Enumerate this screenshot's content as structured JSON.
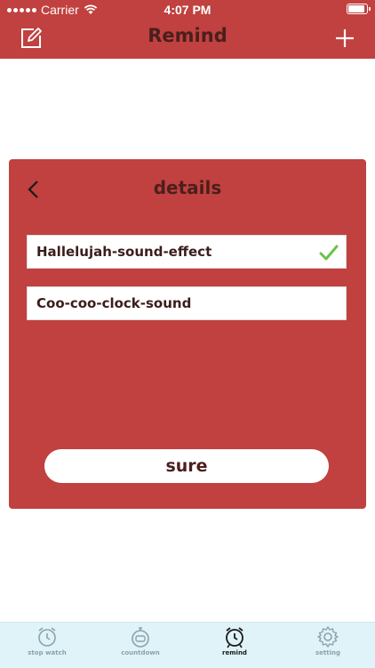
{
  "status_bar": {
    "carrier": "Carrier",
    "time": "4:07 PM"
  },
  "nav": {
    "title": "Remind",
    "left_icon": "edit-icon",
    "right_icon": "plus-icon"
  },
  "details_panel": {
    "title": "details",
    "sounds": [
      {
        "name": "Hallelujah-sound-effect",
        "selected": true
      },
      {
        "name": "Coo-coo-clock-sound",
        "selected": false
      }
    ],
    "confirm_label": "sure"
  },
  "tabbar": {
    "items": [
      {
        "label": "stop watch",
        "icon": "alarm-clock-icon",
        "active": false
      },
      {
        "label": "countdown",
        "icon": "stopwatch-icon",
        "active": false
      },
      {
        "label": "remind",
        "icon": "alarm-clock-icon",
        "active": true
      },
      {
        "label": "setting",
        "icon": "gear-icon",
        "active": false
      }
    ]
  },
  "colors": {
    "brand_red": "#c0413f",
    "title_text": "#4a1f1c",
    "check_green": "#6cc24a",
    "tabbar_bg": "#dff3f8"
  }
}
